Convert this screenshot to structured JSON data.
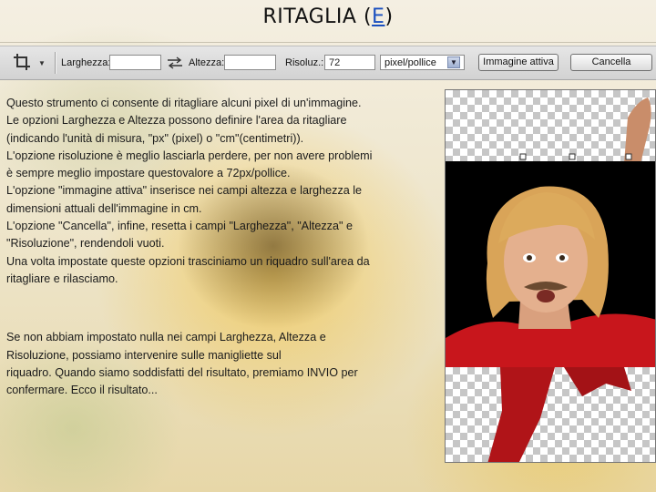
{
  "slide": {
    "title_prefix": "RITAGLIA (",
    "title_link": "E",
    "title_suffix": ")"
  },
  "toolbar": {
    "tool_icon": "crop-icon",
    "width_label": "Larghezza:",
    "width_value": "",
    "swap_icon": "swap-arrows-icon",
    "height_label": "Altezza:",
    "height_value": "",
    "resolution_label": "Risoluz.:",
    "resolution_value": "72",
    "unit_selected": "pixel/pollice",
    "front_image_button": "Immagine attiva",
    "clear_button": "Cancella"
  },
  "body": {
    "paragraph1": [
      "Questo strumento ci consente di ritagliare alcuni pixel di un'immagine.",
      "Le opzioni Larghezza e Altezza possono definire l'area da ritagliare",
      "(indicando l'unità di misura, \"px\" (pixel) o \"cm\"(centimetri)).",
      "L'opzione risoluzione è meglio lasciarla perdere, per non avere problemi",
      "è sempre meglio impostare questovalore a 72px/pollice.",
      "L'opzione \"immagine attiva\" inserisce nei campi altezza e larghezza le",
      "dimensioni attuali dell'immagine in cm.",
      "L'opzione \"Cancella\", infine, resetta i campi \"Larghezza\", \"Altezza\" e",
      "\"Risoluzione\", rendendoli vuoti.",
      "Una volta impostate queste opzioni trasciniamo un riquadro sull'area da",
      "ritagliare e rilasciamo."
    ],
    "paragraph2": [
      "Se non abbiam impostato nulla nei campi Larghezza, Altezza e",
      "Risoluzione, possiamo intervenire sulle manigliette sul",
      "riquadro. Quando siamo soddisfatti del risultato, premiamo INVIO per",
      "confermare. Ecco il risultato..."
    ]
  },
  "colors": {
    "link": "#1a4fbf",
    "shirt": "#c8161c",
    "background_crop": "#000000",
    "wig": "#d9a458"
  }
}
